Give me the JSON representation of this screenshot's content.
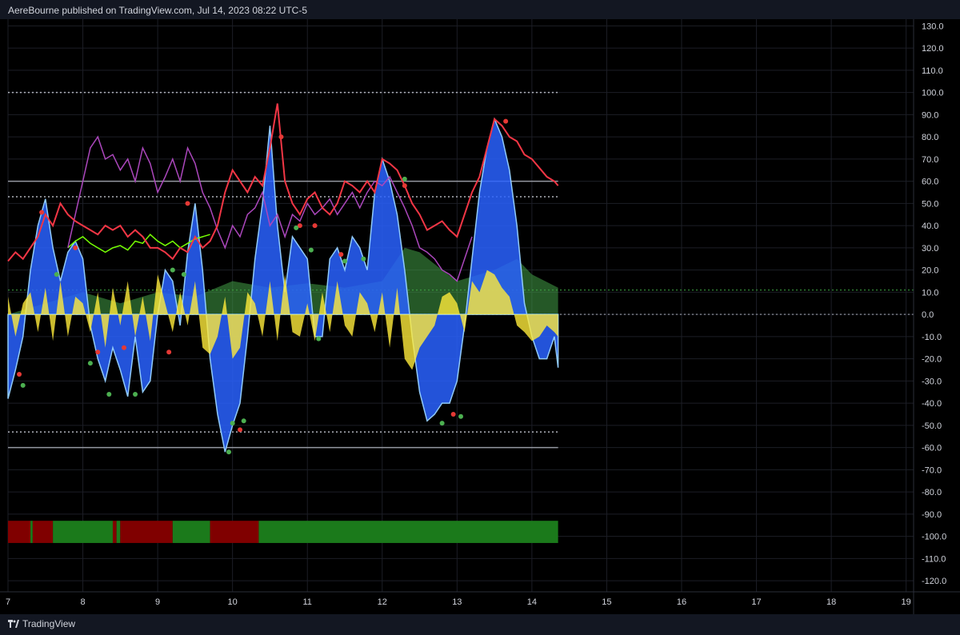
{
  "header": {
    "published_text": "AereBourne published on TradingView.com, Jul 14, 2023 08:22 UTC-5"
  },
  "footer": {
    "brand": "TradingView"
  },
  "chart_data": {
    "type": "line",
    "ylim": [
      -125,
      133
    ],
    "y_ticks": [
      130,
      120,
      110,
      100,
      90,
      80,
      70,
      60,
      50,
      40,
      30,
      20,
      10,
      0,
      -10,
      -20,
      -30,
      -40,
      -50,
      -60,
      -70,
      -80,
      -90,
      -100,
      -110,
      -120
    ],
    "y_tick_labels": [
      "130.0",
      "120.0",
      "110.0",
      "100.0",
      "90.0",
      "80.0",
      "70.0",
      "60.0",
      "50.0",
      "40.0",
      "30.0",
      "20.0",
      "10.0",
      "0.0",
      "-10.0",
      "-20.0",
      "-30.0",
      "-40.0",
      "-50.0",
      "-60.0",
      "-70.0",
      "-80.0",
      "-90.0",
      "-100.0",
      "-110.0",
      "-120.0"
    ],
    "xlim": [
      7,
      19.1
    ],
    "x_ticks": [
      7,
      8,
      9,
      10,
      11,
      12,
      13,
      14,
      15,
      16,
      17,
      18,
      19
    ],
    "x_tick_labels": [
      "7",
      "8",
      "9",
      "10",
      "11",
      "12",
      "13",
      "14",
      "15",
      "16",
      "17",
      "18",
      "19"
    ],
    "hlines": [
      {
        "y": 100,
        "style": "dotted",
        "color": "#b2b5be"
      },
      {
        "y": 60,
        "style": "solid",
        "color": "#9598a1"
      },
      {
        "y": 53,
        "style": "dotted",
        "color": "#b2b5be"
      },
      {
        "y": 11,
        "style": "dotted",
        "color": "#2e7d32"
      },
      {
        "y": 0,
        "style": "dotted",
        "color": "#787b86"
      },
      {
        "y": -53,
        "style": "dotted",
        "color": "#b2b5be"
      },
      {
        "y": -60,
        "style": "solid",
        "color": "#9598a1"
      }
    ],
    "series": [
      {
        "color": "#2962ff",
        "style": "area",
        "x": [
          7.0,
          7.1,
          7.2,
          7.3,
          7.4,
          7.5,
          7.6,
          7.7,
          7.8,
          7.9,
          8.0,
          8.1,
          8.2,
          8.3,
          8.4,
          8.5,
          8.6,
          8.7,
          8.8,
          8.9,
          9.0,
          9.1,
          9.2,
          9.3,
          9.4,
          9.5,
          9.6,
          9.7,
          9.8,
          9.9,
          10.0,
          10.1,
          10.2,
          10.3,
          10.4,
          10.5,
          10.6,
          10.7,
          10.8,
          10.9,
          11.0,
          11.1,
          11.2,
          11.3,
          11.4,
          11.5,
          11.6,
          11.7,
          11.8,
          11.9,
          12.0,
          12.1,
          12.2,
          12.3,
          12.4,
          12.5,
          12.6,
          12.7,
          12.8,
          12.9,
          13.0,
          13.1,
          13.2,
          13.3,
          13.4,
          13.5,
          13.6,
          13.7,
          13.8,
          13.9,
          14.0,
          14.1,
          14.2,
          14.3,
          14.35
        ],
        "values": [
          -38,
          -25,
          -10,
          20,
          40,
          52,
          30,
          15,
          28,
          33,
          25,
          -5,
          -20,
          -30,
          -15,
          -25,
          -37,
          -10,
          -35,
          -30,
          0,
          20,
          15,
          -5,
          28,
          50,
          20,
          -20,
          -45,
          -62,
          -50,
          -40,
          -10,
          25,
          50,
          85,
          40,
          10,
          35,
          30,
          25,
          -10,
          -10,
          25,
          30,
          20,
          35,
          30,
          20,
          55,
          70,
          60,
          45,
          20,
          -10,
          -35,
          -48,
          -45,
          -40,
          -40,
          -30,
          -5,
          25,
          55,
          75,
          88,
          80,
          65,
          40,
          5,
          -10,
          -20,
          -20,
          -10,
          -24
        ]
      },
      {
        "color": "#f23645",
        "style": "line",
        "x": [
          7.0,
          7.1,
          7.2,
          7.3,
          7.4,
          7.5,
          7.6,
          7.7,
          7.8,
          7.9,
          8.0,
          8.1,
          8.2,
          8.3,
          8.4,
          8.5,
          8.6,
          8.7,
          8.8,
          8.9,
          9.0,
          9.1,
          9.2,
          9.3,
          9.4,
          9.5,
          9.6,
          9.7,
          9.8,
          9.9,
          10.0,
          10.1,
          10.2,
          10.3,
          10.4,
          10.5,
          10.6,
          10.7,
          10.8,
          10.9,
          11.0,
          11.1,
          11.2,
          11.3,
          11.4,
          11.5,
          11.6,
          11.7,
          11.8,
          11.9,
          12.0,
          12.1,
          12.2,
          12.3,
          12.4,
          12.5,
          12.6,
          12.7,
          12.8,
          12.9,
          13.0,
          13.1,
          13.2,
          13.3,
          13.4,
          13.5,
          13.6,
          13.7,
          13.8,
          13.9,
          14.0,
          14.1,
          14.2,
          14.3,
          14.35
        ],
        "values": [
          24,
          28,
          25,
          30,
          35,
          45,
          40,
          50,
          45,
          42,
          40,
          38,
          36,
          40,
          38,
          40,
          35,
          38,
          35,
          30,
          30,
          28,
          25,
          30,
          28,
          35,
          30,
          33,
          40,
          55,
          65,
          60,
          55,
          62,
          58,
          75,
          95,
          60,
          50,
          45,
          52,
          55,
          48,
          45,
          50,
          60,
          58,
          55,
          60,
          55,
          70,
          68,
          65,
          58,
          50,
          45,
          38,
          40,
          42,
          38,
          35,
          45,
          55,
          62,
          75,
          88,
          85,
          80,
          78,
          72,
          70,
          66,
          62,
          60,
          58
        ]
      },
      {
        "color": "#ab47bc",
        "style": "line",
        "x": [
          7.8,
          7.9,
          8.0,
          8.1,
          8.2,
          8.3,
          8.4,
          8.5,
          8.6,
          8.7,
          8.8,
          8.9,
          9.0,
          9.1,
          9.2,
          9.3,
          9.4,
          9.5,
          9.6,
          9.7,
          9.8,
          9.9,
          10.0,
          10.1,
          10.2,
          10.3,
          10.4,
          10.5,
          10.6,
          10.7,
          10.8,
          10.9,
          11.0,
          11.1,
          11.2,
          11.3,
          11.4,
          11.5,
          11.6,
          11.7,
          11.8,
          11.9,
          12.0,
          12.1,
          12.2,
          12.3,
          12.4,
          12.5,
          12.6,
          12.7,
          12.8,
          12.9,
          13.0,
          13.1,
          13.2
        ],
        "values": [
          30,
          45,
          60,
          75,
          80,
          70,
          72,
          65,
          70,
          60,
          75,
          68,
          55,
          62,
          70,
          60,
          75,
          68,
          55,
          48,
          38,
          30,
          40,
          35,
          45,
          48,
          55,
          40,
          45,
          35,
          45,
          42,
          50,
          45,
          48,
          52,
          45,
          50,
          55,
          48,
          55,
          60,
          58,
          62,
          55,
          48,
          40,
          30,
          28,
          25,
          20,
          18,
          15,
          25,
          35
        ]
      },
      {
        "color": "#76ff03",
        "style": "line",
        "x": [
          7.8,
          7.9,
          8.0,
          8.1,
          8.2,
          8.3,
          8.4,
          8.5,
          8.6,
          8.7,
          8.8,
          8.9,
          9.0,
          9.1,
          9.2,
          9.3,
          9.4,
          9.5,
          9.6,
          9.7
        ],
        "values": [
          30,
          33,
          35,
          32,
          30,
          28,
          30,
          31,
          29,
          33,
          32,
          36,
          33,
          31,
          33,
          30,
          32,
          34,
          35,
          36
        ]
      },
      {
        "color": "#ffeb3b",
        "style": "histogram",
        "x": [
          7.0,
          7.1,
          7.2,
          7.3,
          7.4,
          7.5,
          7.6,
          7.7,
          7.8,
          7.9,
          8.0,
          8.1,
          8.2,
          8.3,
          8.4,
          8.5,
          8.6,
          8.7,
          8.8,
          8.9,
          9.0,
          9.1,
          9.2,
          9.3,
          9.4,
          9.5,
          9.6,
          9.7,
          9.8,
          9.9,
          10.0,
          10.1,
          10.2,
          10.3,
          10.4,
          10.5,
          10.6,
          10.7,
          10.8,
          10.9,
          11.0,
          11.1,
          11.2,
          11.3,
          11.4,
          11.5,
          11.6,
          11.7,
          11.8,
          11.9,
          12.0,
          12.1,
          12.2,
          12.3,
          12.4,
          12.5,
          12.6,
          12.7,
          12.8,
          12.9,
          13.0,
          13.1,
          13.2,
          13.3,
          13.4,
          13.5,
          13.6,
          13.7,
          13.8,
          13.9,
          14.0,
          14.1,
          14.2,
          14.3,
          14.35
        ],
        "values": [
          8,
          -10,
          5,
          10,
          -8,
          12,
          -12,
          15,
          -10,
          8,
          5,
          -8,
          10,
          -15,
          12,
          -5,
          15,
          -10,
          8,
          -12,
          18,
          5,
          -8,
          10,
          -5,
          15,
          -15,
          -18,
          -10,
          8,
          -20,
          -15,
          10,
          5,
          -10,
          15,
          -12,
          18,
          -8,
          -10,
          5,
          -12,
          10,
          -8,
          15,
          -5,
          -10,
          10,
          5,
          -8,
          10,
          -15,
          12,
          -20,
          -25,
          -15,
          -10,
          -5,
          8,
          10,
          5,
          -8,
          15,
          10,
          20,
          18,
          12,
          8,
          -5,
          -8,
          -12,
          -10,
          -5,
          -8,
          -10
        ]
      },
      {
        "color": "#43a047",
        "style": "area",
        "x": [
          7.0,
          7.5,
          8.0,
          8.5,
          9.0,
          9.5,
          10.0,
          10.5,
          11.0,
          11.5,
          12.0,
          12.3,
          12.5,
          12.8,
          13.0,
          13.5,
          13.8,
          14.0,
          14.35
        ],
        "values": [
          0,
          5,
          10,
          5,
          10,
          8,
          15,
          12,
          14,
          12,
          15,
          30,
          28,
          20,
          15,
          20,
          25,
          18,
          12
        ]
      }
    ],
    "markers_red": [
      [
        7.45,
        46
      ],
      [
        7.9,
        30
      ],
      [
        9.4,
        50
      ],
      [
        10.65,
        80
      ],
      [
        10.9,
        40
      ],
      [
        11.1,
        40
      ],
      [
        11.45,
        27
      ],
      [
        12.3,
        58
      ],
      [
        12.95,
        -45
      ],
      [
        13.65,
        87
      ],
      [
        7.15,
        -27
      ],
      [
        8.2,
        -17
      ],
      [
        8.55,
        -15
      ],
      [
        9.15,
        -17
      ],
      [
        10.1,
        -52
      ]
    ],
    "markers_green": [
      [
        7.65,
        18
      ],
      [
        9.2,
        20
      ],
      [
        9.35,
        18
      ],
      [
        10.0,
        -49
      ],
      [
        10.15,
        -48
      ],
      [
        10.85,
        39
      ],
      [
        11.05,
        29
      ],
      [
        11.15,
        -11
      ],
      [
        11.5,
        24
      ],
      [
        11.75,
        25
      ],
      [
        12.3,
        61
      ],
      [
        7.2,
        -32
      ],
      [
        8.1,
        -22
      ],
      [
        8.35,
        -36
      ],
      [
        8.7,
        -36
      ],
      [
        9.95,
        -62
      ],
      [
        12.8,
        -49
      ],
      [
        13.05,
        -46
      ]
    ],
    "bottom_bar": {
      "y_range": [
        -93,
        -103
      ],
      "segments": [
        {
          "from": 7.0,
          "to": 7.3,
          "color": "#800000"
        },
        {
          "from": 7.3,
          "to": 7.33,
          "color": "#1b7a1b"
        },
        {
          "from": 7.33,
          "to": 7.6,
          "color": "#800000"
        },
        {
          "from": 7.6,
          "to": 8.4,
          "color": "#1b7a1b"
        },
        {
          "from": 8.4,
          "to": 8.45,
          "color": "#800000"
        },
        {
          "from": 8.45,
          "to": 8.5,
          "color": "#1b7a1b"
        },
        {
          "from": 8.5,
          "to": 9.2,
          "color": "#800000"
        },
        {
          "from": 9.2,
          "to": 9.7,
          "color": "#1b7a1b"
        },
        {
          "from": 9.7,
          "to": 10.35,
          "color": "#800000"
        },
        {
          "from": 10.35,
          "to": 14.35,
          "color": "#1b7a1b"
        }
      ]
    }
  }
}
